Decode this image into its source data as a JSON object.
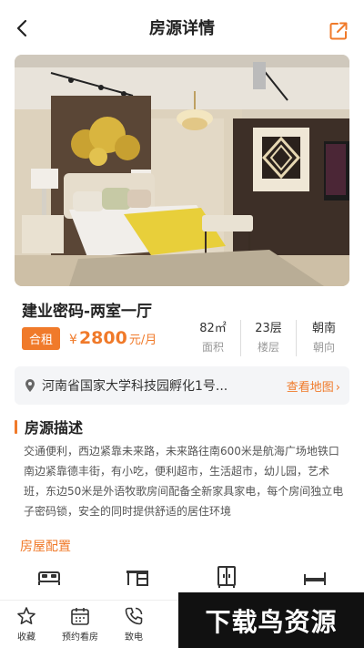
{
  "header": {
    "title": "房源详情"
  },
  "listing": {
    "title": "建业密码-两室一厅",
    "tag": "合租",
    "price_currency": "¥",
    "price_amount": "2800",
    "price_unit": "元/月",
    "stats": [
      {
        "value": "82㎡",
        "label": "面积"
      },
      {
        "value": "23层",
        "label": "楼层"
      },
      {
        "value": "朝南",
        "label": "朝向"
      }
    ]
  },
  "address": {
    "text": "河南省国家大学科技园孵化1号...",
    "map_link": "查看地图",
    "chevron": "›"
  },
  "description": {
    "heading": "房源描述",
    "body": "交通便利，西边紧靠未来路，未来路往南600米是航海广场地铁口南边紧靠德丰街，有小吃，便利超市，生活超市，幼儿园，艺术班，东边50米是外语牧歌房间配备全新家具家电，每个房间独立电子密码锁，安全的同时提供舒适的居住环境"
  },
  "config": {
    "heading": "房屋配置",
    "icons": [
      "bed-icon",
      "desk-icon",
      "wardrobe-icon",
      "sofa-bed-icon"
    ]
  },
  "bottom_bar": {
    "favorite": "收藏",
    "book_visit": "预约看房",
    "call": "致电"
  },
  "watermark": "下载鸟资源",
  "colors": {
    "accent": "#f07a2a",
    "hero_wall": "#d9cfbd",
    "bedspread": "#e8cf3a"
  }
}
